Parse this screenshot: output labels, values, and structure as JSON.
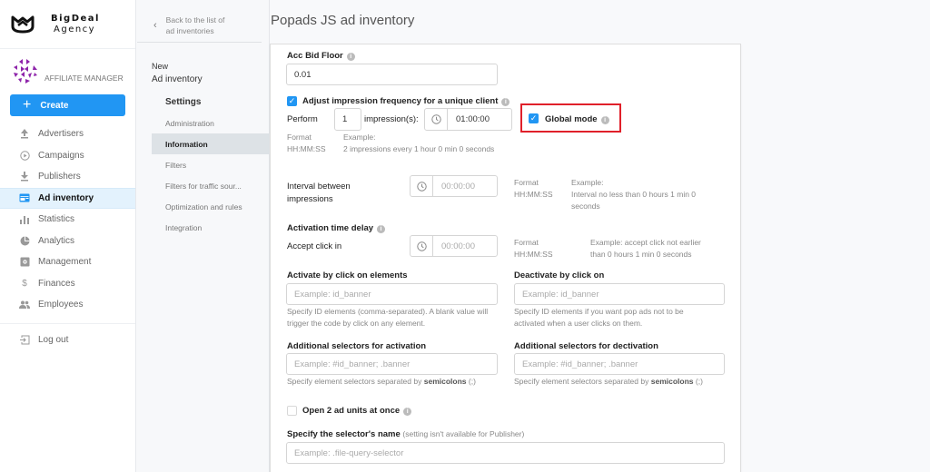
{
  "brand": {
    "line1": "BigDeal",
    "line2": "Agency"
  },
  "role": {
    "label": "AFFILIATE MANAGER"
  },
  "create_button": {
    "label": "Create",
    "icon": "plus-icon"
  },
  "colors": {
    "accent": "#2196f3",
    "highlight": "#e0202a",
    "active_nav_bg": "#e3f2fd",
    "active_sub_bg": "#dde2e6"
  },
  "nav": {
    "items": [
      {
        "label": "Advertisers",
        "icon": "upload-icon"
      },
      {
        "label": "Campaigns",
        "icon": "play-circle-icon"
      },
      {
        "label": "Publishers",
        "icon": "download-icon"
      },
      {
        "label": "Ad inventory",
        "icon": "ad-inventory-icon",
        "active": true
      },
      {
        "label": "Statistics",
        "icon": "bar-chart-icon"
      },
      {
        "label": "Analytics",
        "icon": "pie-chart-icon"
      },
      {
        "label": "Management",
        "icon": "management-icon"
      },
      {
        "label": "Finances",
        "icon": "dollar-icon"
      },
      {
        "label": "Employees",
        "icon": "people-icon"
      }
    ],
    "logout": {
      "label": "Log out",
      "icon": "logout-icon"
    }
  },
  "subpanel": {
    "back_label_line1": "Back to the list of",
    "back_label_line2": "ad inventories",
    "new_label": "New",
    "entity_label": "Ad inventory",
    "settings_label": "Settings",
    "items": [
      {
        "label": "Administration"
      },
      {
        "label": "Information",
        "active": true
      },
      {
        "label": "Filters"
      },
      {
        "label": "Filters for traffic sour..."
      },
      {
        "label": "Optimization and rules"
      },
      {
        "label": "Integration"
      }
    ]
  },
  "page": {
    "title": "Popads JS ad inventory"
  },
  "form": {
    "acc_bid_floor": {
      "label": "Acc Bid Floor",
      "value": "0.01"
    },
    "adjust_frequency": {
      "label": "Adjust impression frequency for a unique client",
      "checked": true,
      "perform_label": "Perform",
      "impressions_value": "1",
      "impressions_label": "impression(s):",
      "time_value": "01:00:00",
      "format_label": "Format",
      "format_value": "HH:MM:SS",
      "example_label": "Example:",
      "example_text": "2 impressions every 1 hour 0 min 0 seconds"
    },
    "global_mode": {
      "label": "Global mode",
      "checked": true
    },
    "interval": {
      "label_line1": "Interval between",
      "label_line2": "impressions",
      "placeholder": "00:00:00",
      "format_label": "Format",
      "format_value": "HH:MM:SS",
      "example_label": "Example:",
      "example_text": "Interval no less than 0 hours 1 min 0 seconds"
    },
    "activation_delay": {
      "label": "Activation time delay",
      "accept_label": "Accept click in",
      "placeholder": "00:00:00",
      "format_label": "Format",
      "format_value": "HH:MM:SS",
      "example_text_line1": "Example: accept click not earlier",
      "example_text_line2": "than 0 hours 1 min 0 seconds"
    },
    "activate_click": {
      "label": "Activate by click on elements",
      "placeholder": "Example: id_banner",
      "hint": "Specify ID elements (comma-separated). A blank value will trigger the code by click on any element."
    },
    "deactivate_click": {
      "label": "Deactivate by click on",
      "placeholder": "Example: id_banner",
      "hint": "Specify ID elements if you want pop ads not to be activated when a user clicks on them."
    },
    "add_sel_activation": {
      "label": "Additional selectors for activation",
      "placeholder": "Example: #id_banner; .banner",
      "hint_prefix": "Specify element selectors separated by",
      "hint_bold": "semicolons",
      "hint_suffix": "(;)"
    },
    "add_sel_deactivation": {
      "label": "Additional selectors for dectivation",
      "placeholder": "Example: #id_banner; .banner",
      "hint_prefix": "Specify element selectors separated by",
      "hint_bold": "semicolons",
      "hint_suffix": "(;)"
    },
    "open_two": {
      "label": "Open 2 ad units at once",
      "checked": false
    },
    "selector_name": {
      "label": "Specify the selector's name",
      "note": "(setting isn't available for Publisher)",
      "placeholder": "Example: .file-query-selector"
    }
  }
}
